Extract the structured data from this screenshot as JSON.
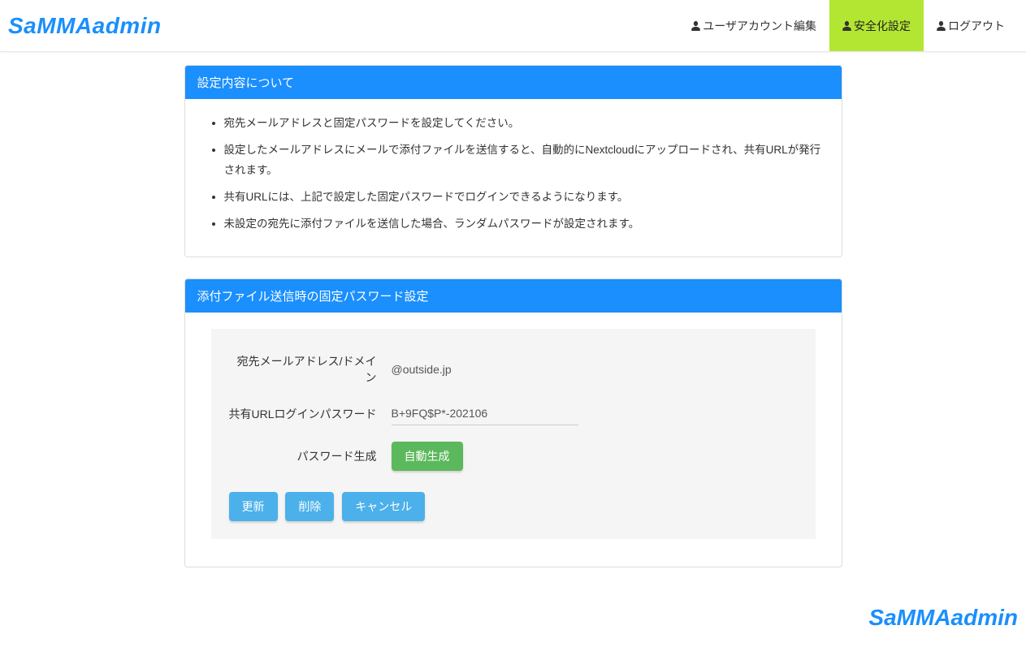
{
  "brand": "SaMMAadmin",
  "nav": {
    "user_account_edit": "ユーザアカウント編集",
    "security_settings": "安全化設定",
    "logout": "ログアウト"
  },
  "panel_about": {
    "title": "設定内容について",
    "items": [
      "宛先メールアドレスと固定パスワードを設定してください。",
      "設定したメールアドレスにメールで添付ファイルを送信すると、自動的にNextcloudにアップロードされ、共有URLが発行されます。",
      "共有URLには、上記で設定した固定パスワードでログインできるようになります。",
      "未設定の宛先に添付ファイルを送信した場合、ランダムパスワードが設定されます。"
    ]
  },
  "panel_form": {
    "title": "添付ファイル送信時の固定パスワード設定",
    "label_address": "宛先メールアドレス/ドメイン",
    "value_address": "@outside.jp",
    "label_password": "共有URLログインパスワード",
    "value_password": "B+9FQ$P*-202106",
    "label_generate": "パスワード生成",
    "btn_generate": "自動生成",
    "btn_update": "更新",
    "btn_delete": "削除",
    "btn_cancel": "キャンセル"
  },
  "footer_brand": "SaMMAadmin"
}
